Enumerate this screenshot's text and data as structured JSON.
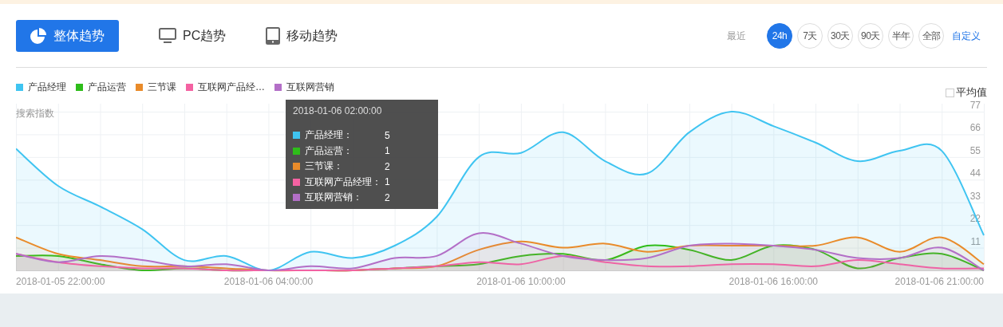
{
  "tabs": [
    {
      "label": "整体趋势",
      "kind": "overall",
      "selected": true
    },
    {
      "label": "PC趋势",
      "kind": "pc",
      "selected": false
    },
    {
      "label": "移动趋势",
      "kind": "mobile",
      "selected": false
    }
  ],
  "range": {
    "label": "最近",
    "options": [
      {
        "label": "24h",
        "selected": true
      },
      {
        "label": "7天",
        "selected": false
      },
      {
        "label": "30天",
        "selected": false
      },
      {
        "label": "90天",
        "selected": false
      },
      {
        "label": "半年",
        "selected": false
      },
      {
        "label": "全部",
        "selected": false
      }
    ],
    "custom_link": "自定义"
  },
  "average_checkbox": {
    "label": "平均值",
    "checked": false
  },
  "chart_data": {
    "type": "area",
    "ylabel": "搜索指数",
    "categories": [
      null,
      null,
      null,
      null,
      null,
      null,
      "2018-01-06 04:00:00",
      null,
      null,
      null,
      null,
      null,
      "2018-01-06 10:00:00",
      null,
      null,
      null,
      null,
      null,
      "2018-01-06 16:00:00",
      null,
      null,
      null,
      null,
      null
    ],
    "ylim": [
      0,
      77
    ],
    "yticks": [
      11,
      22,
      33,
      44,
      55,
      66,
      77
    ],
    "grid": true,
    "series": [
      {
        "name": "产品经理",
        "color": "#3fc4f1",
        "values": [
          59,
          41,
          31,
          20,
          5,
          7,
          0,
          9,
          6,
          12,
          26,
          55,
          57,
          67,
          53,
          47,
          67,
          77,
          70,
          62,
          53,
          58,
          58,
          17
        ]
      },
      {
        "name": "产品运营",
        "color": "#2ebd1a",
        "values": [
          7,
          7,
          3,
          0,
          1,
          0,
          0,
          0,
          0,
          1,
          2,
          3,
          7,
          8,
          5,
          12,
          10,
          5,
          12,
          10,
          1,
          6,
          8,
          0
        ]
      },
      {
        "name": "三节课",
        "color": "#e98b2a",
        "values": [
          16,
          8,
          5,
          2,
          2,
          1,
          0,
          0,
          0,
          1,
          2,
          10,
          14,
          11,
          13,
          9,
          12,
          12,
          12,
          12,
          16,
          9,
          16,
          3
        ]
      },
      {
        "name": "互联网产品经…",
        "color": "#f462a2",
        "values": [
          8,
          4,
          2,
          1,
          1,
          0,
          0,
          0,
          0,
          1,
          2,
          4,
          3,
          7,
          4,
          2,
          2,
          3,
          3,
          2,
          5,
          3,
          1,
          1
        ]
      },
      {
        "name": "互联网营销",
        "color": "#b36fc7",
        "values": [
          8,
          4,
          7,
          5,
          2,
          3,
          0,
          2,
          1,
          6,
          7,
          18,
          13,
          7,
          5,
          6,
          12,
          13,
          12,
          10,
          6,
          6,
          11,
          0
        ]
      }
    ]
  },
  "x_axis_ends": {
    "start": "2018-01-05 22:00:00",
    "end": "2018-01-06 21:00:00"
  },
  "tooltip": {
    "time": "2018-01-06 02:00:00",
    "items": [
      {
        "label": "产品经理：",
        "value": "5",
        "color": "#3fc4f1"
      },
      {
        "label": "产品运营：",
        "value": "1",
        "color": "#2ebd1a"
      },
      {
        "label": "三节课：",
        "value": "2",
        "color": "#e98b2a"
      },
      {
        "label": "互联网产品经理：",
        "value": "1",
        "color": "#f462a2"
      },
      {
        "label": "互联网营销：",
        "value": "2",
        "color": "#b36fc7"
      }
    ]
  }
}
